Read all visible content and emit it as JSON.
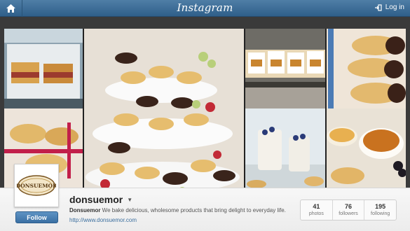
{
  "header": {
    "brand": "Instagram",
    "login_label": "Log in"
  },
  "profile": {
    "username": "donsuemor",
    "bio_name": "Donsuemor",
    "bio_text": " We bake delicious, wholesome products that bring delight to everyday life.",
    "website": "http://www.donsuemor.com",
    "follow_label": "Follow",
    "logo_text": "DONSUEMOR"
  },
  "stats": [
    {
      "num": "41",
      "label": "photos"
    },
    {
      "num": "76",
      "label": "followers"
    },
    {
      "num": "195",
      "label": "following"
    }
  ],
  "icons": {
    "home": "home-icon",
    "login": "login-icon",
    "dropdown": "caret-down-icon"
  },
  "colors": {
    "topbar": "#3b6a94",
    "follow": "#4a80b4",
    "link": "#3b6e9e"
  }
}
